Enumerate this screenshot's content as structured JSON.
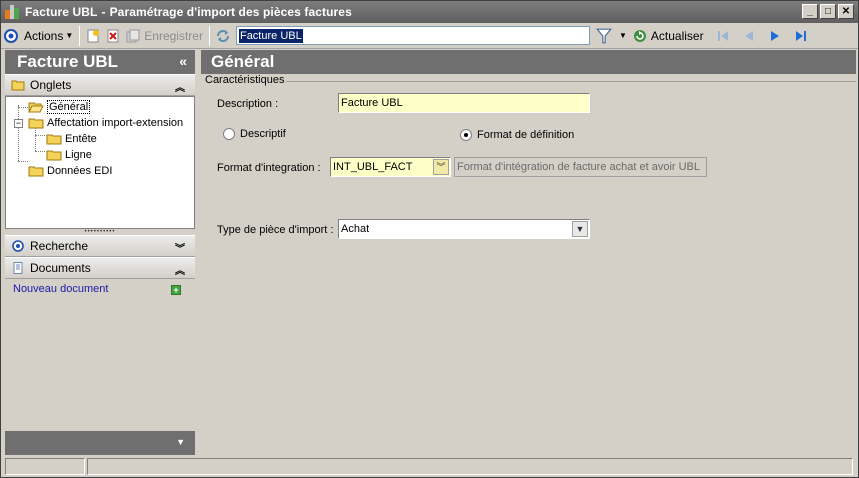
{
  "window": {
    "title_app": "Facture UBL",
    "title_separator": "-",
    "title_doc": "Paramétrage d'import des pièces factures",
    "min_glyph": "_",
    "max_glyph": "□",
    "close_glyph": "✕"
  },
  "toolbar": {
    "actions_label": "Actions",
    "save_label": "Enregistrer",
    "search_value": "Facture UBL",
    "refresh_label": "Actualiser"
  },
  "left": {
    "header": "Facture UBL",
    "collapse_glyph": "«",
    "tabs_section": "Onglets",
    "tree": [
      {
        "label": "Général"
      },
      {
        "label": "Affectation import-extension"
      },
      {
        "label": "Entête"
      },
      {
        "label": "Ligne"
      },
      {
        "label": "Données EDI"
      }
    ],
    "search_section": "Recherche",
    "documents_section": "Documents",
    "new_document": "Nouveau document"
  },
  "main": {
    "header": "Général",
    "group_title": "Caractéristiques",
    "description_label": "Description :",
    "description_value": "Facture UBL",
    "radio_descriptif": "Descriptif",
    "radio_format": "Format de définition",
    "format_label": "Format d'integration :",
    "format_value": "INT_UBL_FACT",
    "format_desc": "Format d'intégration de facture achat et avoir UBL",
    "type_label": "Type de pièce d'import :",
    "type_value": "Achat"
  },
  "colors": {
    "header_gray": "#6f6f6f",
    "input_yellow": "#ffffc8",
    "nav_blue": "#1e6fd9",
    "selection_blue": "#0a246a"
  }
}
